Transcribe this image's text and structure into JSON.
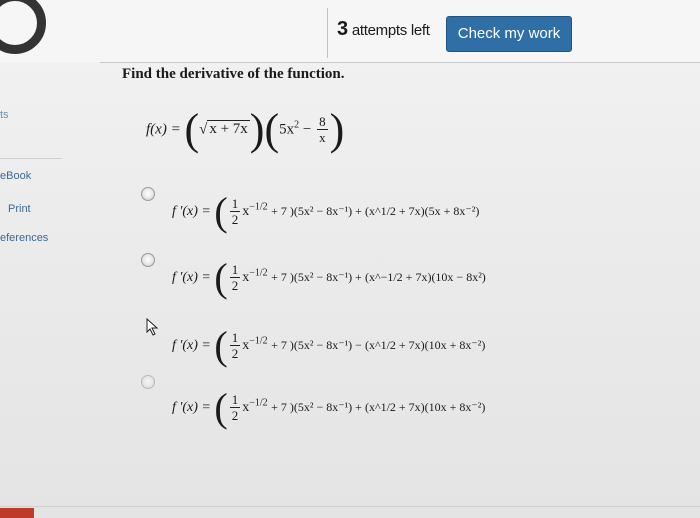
{
  "header": {
    "attempts_number": "3",
    "attempts_text": "attempts left",
    "check_button": "Check my work"
  },
  "sidebar": {
    "items": [
      {
        "label": "ts"
      },
      {
        "label": "eBook"
      },
      {
        "label": "Print"
      },
      {
        "label": "eferences"
      }
    ]
  },
  "question": {
    "prompt": "Find the derivative of the function.",
    "function": {
      "lhs": "f(x) = ",
      "first": "x + 7x",
      "second_a": "5x",
      "second_b": "2",
      "frac_num": "8",
      "frac_den": "x"
    }
  },
  "options": [
    {
      "label": "f '(x) = ",
      "half_num": "1",
      "half_den": "2",
      "mid": "x",
      "mid_exp": "−1/2",
      "tail": "+ 7 )(5x² − 8x⁻¹) + (x^1/2 + 7x)(5x + 8x⁻²)",
      "selected": false
    },
    {
      "label": "f '(x) = ",
      "half_num": "1",
      "half_den": "2",
      "mid": "x",
      "mid_exp": "−1/2",
      "tail": "+ 7 )(5x² − 8x⁻¹) + (x^−1/2 + 7x)(10x − 8x²)",
      "selected": false
    },
    {
      "label": "f '(x) = ",
      "half_num": "1",
      "half_den": "2",
      "mid": "x",
      "mid_exp": "−1/2",
      "tail": "+ 7 )(5x² − 8x⁻¹) − (x^1/2 + 7x)(10x + 8x⁻²)",
      "selected": true
    },
    {
      "label": "f '(x) = ",
      "half_num": "1",
      "half_den": "2",
      "mid": "x",
      "mid_exp": "−1/2",
      "tail": "+ 7 )(5x² − 8x⁻¹) + (x^1/2 + 7x)(10x + 8x⁻²)",
      "selected": false
    }
  ]
}
